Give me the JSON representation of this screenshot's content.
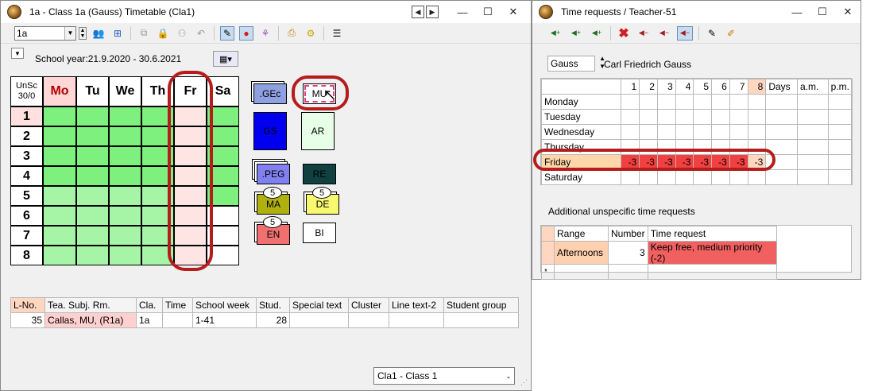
{
  "left": {
    "title": "1a - Class 1a (Gauss)  Timetable  (Cla1)",
    "class_select": "1a",
    "school_year": "School year:21.9.2020 - 30.6.2021",
    "corner_top": "UnSc",
    "corner_bottom": "30/0",
    "days": [
      "Mo",
      "Tu",
      "We",
      "Th",
      "Fr",
      "Sa"
    ],
    "periods": [
      "1",
      "2",
      "3",
      "4",
      "5",
      "6",
      "7",
      "8"
    ],
    "cards": {
      "gec": ".GEc",
      "mu": "MU",
      "gs": "GS",
      "ar": "AR",
      "peg": ".PEG",
      "re": "RE",
      "ma": "MA",
      "de": "DE",
      "en": "EN",
      "bi": "BI",
      "ma_count": "5",
      "de_count": "5",
      "en_count": "5"
    },
    "lesson_table": {
      "headers": [
        "L-No.",
        "Tea. Subj. Rm.",
        "Cla.",
        "Time",
        "School week",
        "Stud.",
        "Special text",
        "Cluster",
        "Line text-2",
        "Student group"
      ],
      "row": {
        "lno": "35",
        "tsr": "Callas, MU, (R1a)",
        "cla": "1a",
        "time": "",
        "week": "1-41",
        "stud": "28"
      }
    },
    "bottom_select": "Cla1 - Class 1"
  },
  "right": {
    "title": "Time requests / Teacher-51",
    "teacher_short": "Gauss",
    "teacher_name": "Carl Friedrich Gauss",
    "period_headers": [
      "1",
      "2",
      "3",
      "4",
      "5",
      "6",
      "7",
      "8"
    ],
    "extra_headers": [
      "Days",
      "a.m.",
      "p.m."
    ],
    "days": [
      "Monday",
      "Tuesday",
      "Wednesday",
      "Thursday",
      "Friday",
      "Saturday"
    ],
    "friday_values": [
      "-3",
      "-3",
      "-3",
      "-3",
      "-3",
      "-3",
      "-3",
      "-3"
    ],
    "additional_label": "Additional unspecific time requests",
    "req_headers": [
      "Range",
      "Number",
      "Time request"
    ],
    "req_row": {
      "range": "Afternoons",
      "number": "3",
      "request": "Keep free, medium priority (-2)"
    },
    "new_row_marker": "*"
  },
  "colors": {
    "green": "#7ef07e",
    "green_light": "#a6f5a6",
    "pink": "#ffe4e4",
    "highlight_red": "#b51c1c",
    "request_red": "#f04040"
  }
}
